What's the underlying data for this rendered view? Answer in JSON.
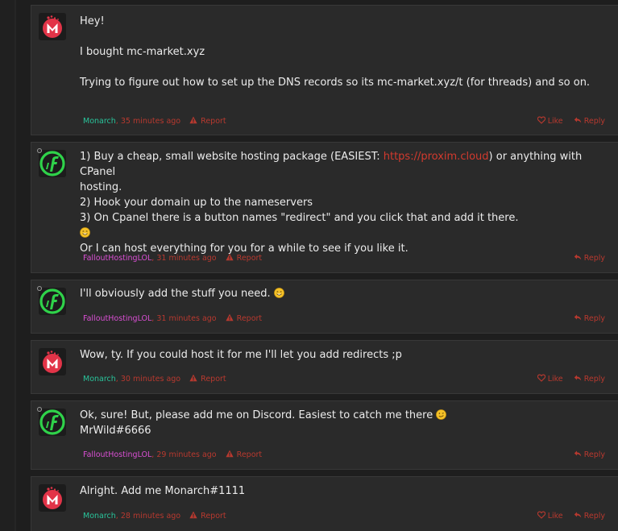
{
  "colors": {
    "background": "#1e1e1e",
    "post_bg": "#2a2a2a",
    "text": "#ececec",
    "accent_red": "#b8392f",
    "link_red": "#d23a2e",
    "author_green": "#29c39a",
    "author_pink": "#d94fd3"
  },
  "labels": {
    "like": "Like",
    "reply": "Reply",
    "report": "Report",
    "comma": ","
  },
  "posts": [
    {
      "author": "Monarch",
      "time": "35 minutes ago",
      "avatar_icon": "monarch-m-logo-icon",
      "lines": {
        "l1": "Hey!",
        "l2": "I bought mc-market.xyz",
        "l3": "Trying to figure out how to set up the DNS records so its mc-market.xyz/t (for threads) and so on."
      }
    },
    {
      "author": "FalloutHostingLOL",
      "time": "31 minutes ago",
      "avatar_icon": "fallout-f-logo-icon",
      "lines": {
        "l1_pre": "1) Buy a cheap, small website hosting package (EASIEST: ",
        "l1_link": "https://proxim.cloud",
        "l1_post": ") or anything with CPanel",
        "l2": "hosting.",
        "l3": "2) Hook your domain up to the nameservers",
        "l4": "3) On Cpanel there is a button names \"redirect\" and you click that and add it there.",
        "l6": "Or I can host everything for you for a while to see if you like it."
      }
    },
    {
      "author": "FalloutHostingLOL",
      "time": "31 minutes ago",
      "avatar_icon": "fallout-f-logo-icon",
      "lines": {
        "l1": "I'll obviously add the stuff you need. "
      }
    },
    {
      "author": "Monarch",
      "time": "30 minutes ago",
      "avatar_icon": "monarch-m-logo-icon",
      "lines": {
        "l1": "Wow, ty. If you could host it for me I'll let you add redirects ;p"
      }
    },
    {
      "author": "FalloutHostingLOL",
      "time": "29 minutes ago",
      "avatar_icon": "fallout-f-logo-icon",
      "lines": {
        "l1": "Ok, sure! But, please add me on Discord. Easiest to catch me there ",
        "l2": "MrWild#6666"
      }
    },
    {
      "author": "Monarch",
      "time": "28 minutes ago",
      "avatar_icon": "monarch-m-logo-icon",
      "lines": {
        "l1": "Alright. Add me Monarch#1111"
      }
    }
  ]
}
